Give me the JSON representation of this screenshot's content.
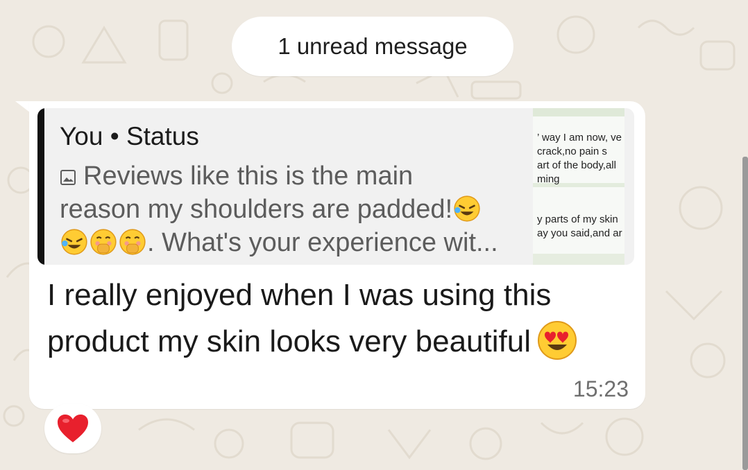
{
  "unread_label": "1 unread message",
  "quote": {
    "author": "You • Status",
    "text_line1": "Reviews like this is the main",
    "text_line2": "reason my shoulders are padded!",
    "text_line3": ". What's your experience wit..."
  },
  "thumbnail": {
    "line1": "’ way I am now, ve",
    "line2": "crack,no pain s",
    "line3": "art of the body,all",
    "line4": "ming",
    "line5": "y parts of my skin",
    "line6": "ay you said,and ar"
  },
  "message": {
    "line1": "I really enjoyed when I was using this",
    "line2": "product  my skin looks very beautiful",
    "time": "15:23"
  },
  "reaction": "heart",
  "colors": {
    "wallpaper": "#efeae2",
    "bubble": "#ffffff",
    "quote_background": "#f1f1f1",
    "quote_bar": "#111111",
    "heart": "#e8202d"
  }
}
